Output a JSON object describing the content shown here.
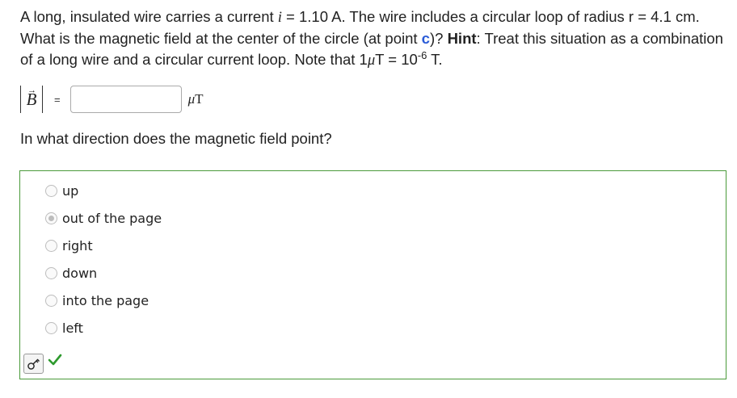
{
  "question": {
    "part1": "A long, insulated wire carries a current ",
    "current_symbol": "i",
    "part2": " = 1.10 A.  The wire includes a circular loop of radius r = 4.1 cm.  What is the magnetic field at the center of the circle (at point ",
    "point_label": "c",
    "part3": ")?  ",
    "hint_label": "Hint",
    "part4": ": Treat this situation as a combination of a long wire and a circular current loop.  Note that 1",
    "mu": "μ",
    "part5": "T = 10",
    "exponent": "-6",
    "part6": " T."
  },
  "answer": {
    "symbol": "B",
    "arrow": "→",
    "equals": "=",
    "value": "",
    "unit_mu": "μ",
    "unit_T": "T"
  },
  "direction_question": "In what direction does the magnetic field point?",
  "choices": [
    {
      "label": "up",
      "selected": false
    },
    {
      "label": "out of the page",
      "selected": true
    },
    {
      "label": "right",
      "selected": false
    },
    {
      "label": "down",
      "selected": false
    },
    {
      "label": "into the page",
      "selected": false
    },
    {
      "label": "left",
      "selected": false
    }
  ],
  "icons": {
    "key_button": "key-icon",
    "status": "checkmark-icon"
  },
  "colors": {
    "correct_border": "#4a9a3a",
    "checkmark": "#2e9a2e",
    "point_label": "#2a5bd7"
  }
}
